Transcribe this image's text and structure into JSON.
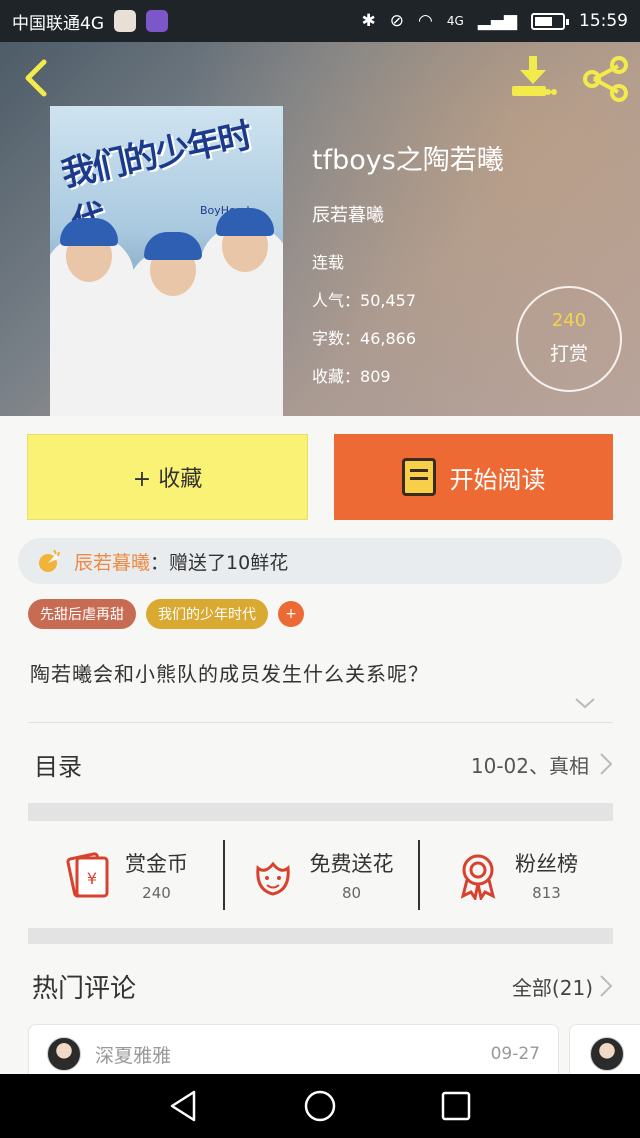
{
  "status_bar": {
    "carrier": "中国联通4G",
    "network": "4G",
    "time": "15:59"
  },
  "header": {
    "icons": [
      "back-arrow-icon",
      "download-icon",
      "share-icon"
    ],
    "cover": {
      "title": "我们的少年时代",
      "subtitle": "BoyHood"
    }
  },
  "book": {
    "title": "tfboys之陶若曦",
    "author": "辰若暮曦",
    "status": "连载",
    "popularity_label": "人气：",
    "popularity": "50,457",
    "word_count_label": "字数：",
    "word_count": "46,866",
    "favorites_label": "收藏：",
    "favorites": "809"
  },
  "tip": {
    "count": "240",
    "label": "打赏"
  },
  "actions": {
    "favorite_label": "+ 收藏",
    "read_label": "开始阅读"
  },
  "gift_notice": {
    "sender": "辰若暮曦",
    "message": "：赠送了10鲜花"
  },
  "tags": [
    "先甜后虐再甜",
    "我们的少年时代"
  ],
  "tag_add_label": "+",
  "summary": "陶若曦会和小熊队的成员发生什么关系呢？",
  "toc": {
    "label": "目录",
    "latest": "10-02、真相"
  },
  "stats": [
    {
      "label": "赏金币",
      "value": "240",
      "icon": "red-envelope-icon"
    },
    {
      "label": "免费送花",
      "value": "80",
      "icon": "flower-icon"
    },
    {
      "label": "粉丝榜",
      "value": "813",
      "icon": "medal-icon"
    }
  ],
  "comments": {
    "title": "热门评论",
    "all_label": "全部(21)",
    "items": [
      {
        "user": "深夏雅雅",
        "date": "09-27"
      }
    ]
  },
  "colors": {
    "accent_orange": "#ee6a35",
    "favorite_yellow": "#f9f275",
    "tip_number": "#f4d44a"
  }
}
